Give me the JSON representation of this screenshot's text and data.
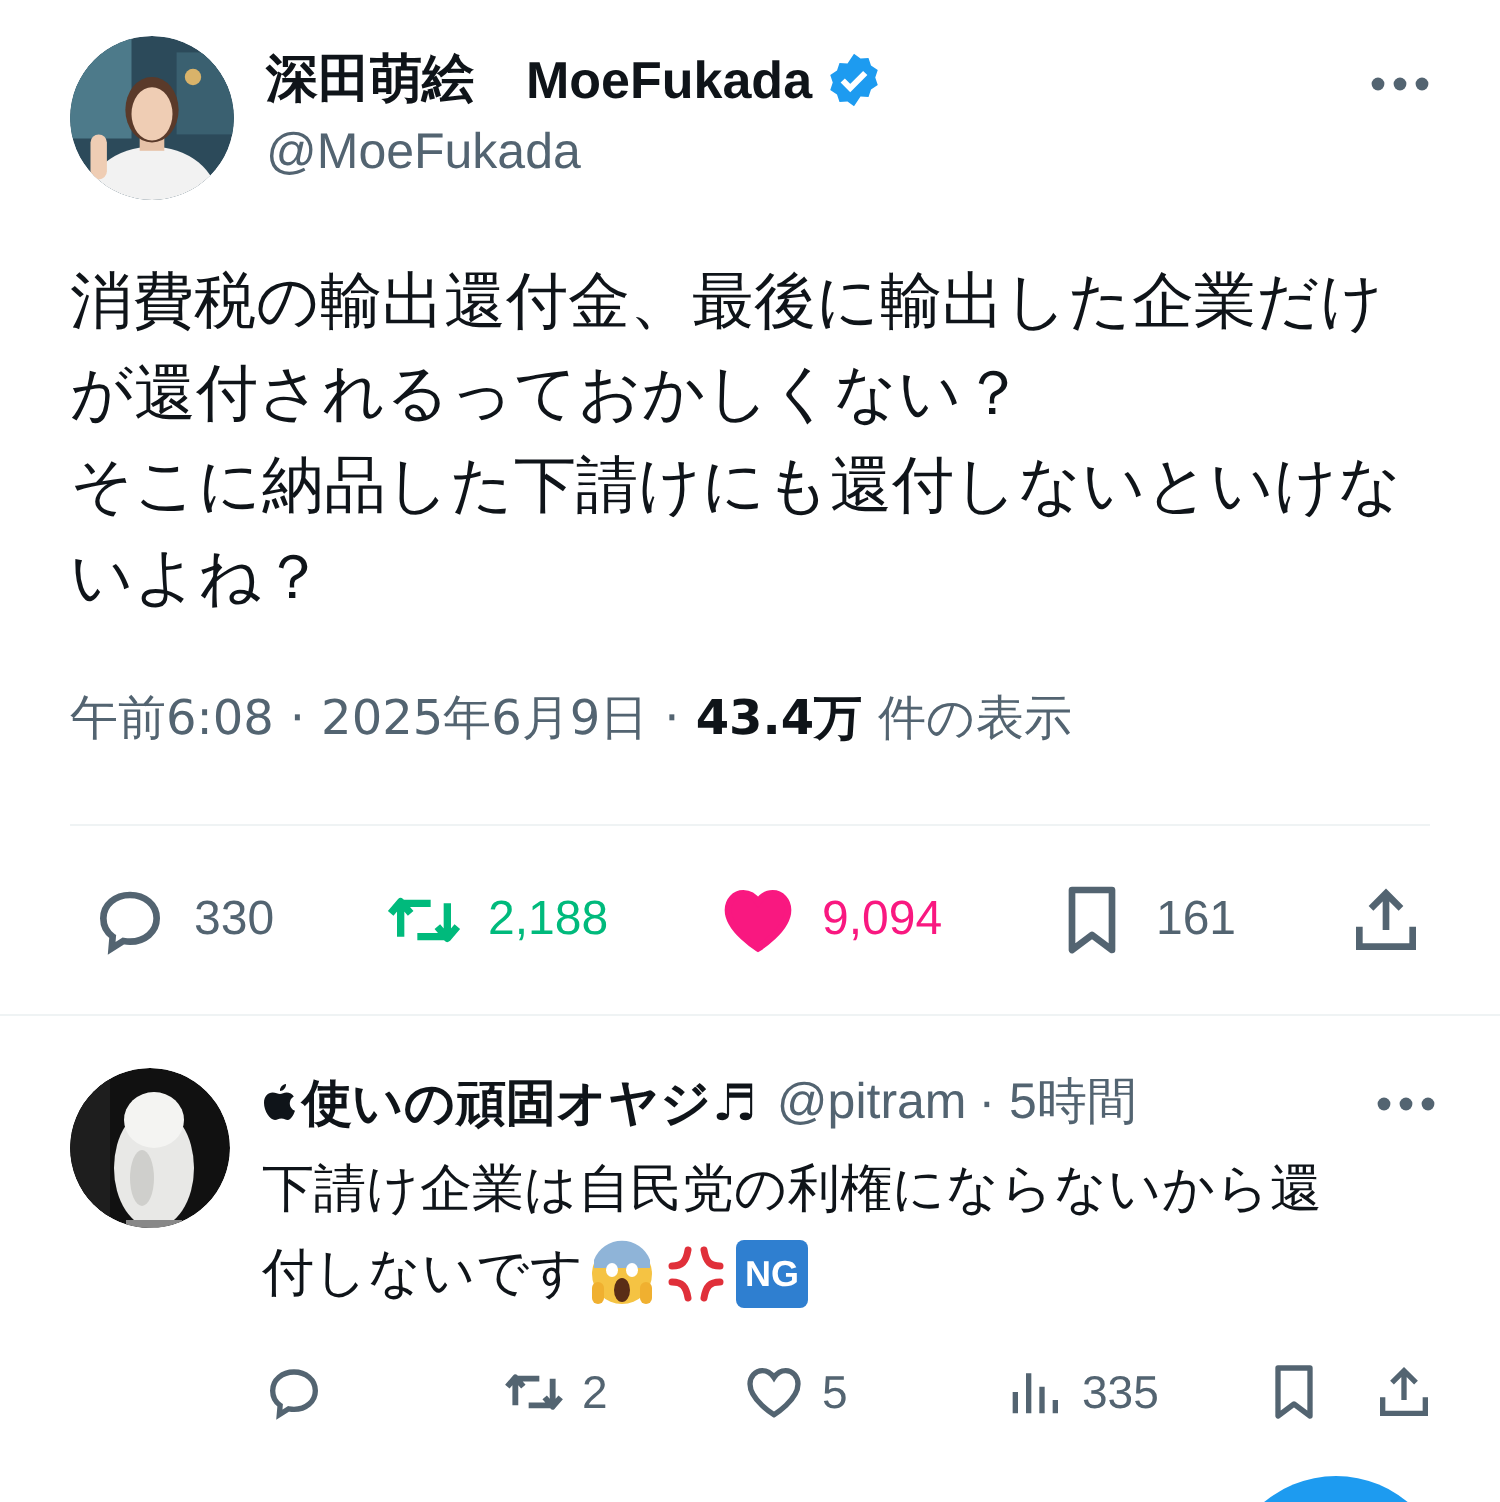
{
  "tweet": {
    "avatar": {
      "kind": "picture"
    },
    "display_name": "深田萌絵",
    "screen_name_bold": "MoeFukada",
    "verified": true,
    "handle": "@MoeFukada",
    "text_lines": [
      "消費税の輸出還付金、最後に輸出した企業だけ",
      "が還付されるっておかしくない？",
      "そこに納品した下請けにも還付しないといけな",
      "いよね？"
    ],
    "time": "午前6:08",
    "separator_1": "·",
    "date": "2025年6月9日",
    "separator_2": "·",
    "views": "43.4万",
    "views_label": "件の表示",
    "actions": [
      {
        "kind": "reply",
        "count": "330"
      },
      {
        "kind": "retweet",
        "count": "2,188",
        "active": true
      },
      {
        "kind": "like",
        "count": "9,094",
        "active": true
      },
      {
        "kind": "bookmark",
        "count": "161"
      },
      {
        "kind": "share"
      }
    ]
  },
  "replies": [
    {
      "avatar": {
        "kind": "picture"
      },
      "name": "使いの頑固オヤジ♬",
      "handle": "@pitram",
      "time": "· 5時間",
      "text_lines": [
        "下請け企業は自民党の利権にならないから還",
        "付しないです"
      ],
      "badge": "NG",
      "actions": [
        {
          "kind": "reply"
        },
        {
          "kind": "retweet",
          "count": "2"
        },
        {
          "kind": "like",
          "count": "5"
        },
        {
          "kind": "views",
          "count": "335"
        },
        {
          "kind": "bookmark"
        },
        {
          "kind": "share"
        }
      ]
    }
  ]
}
